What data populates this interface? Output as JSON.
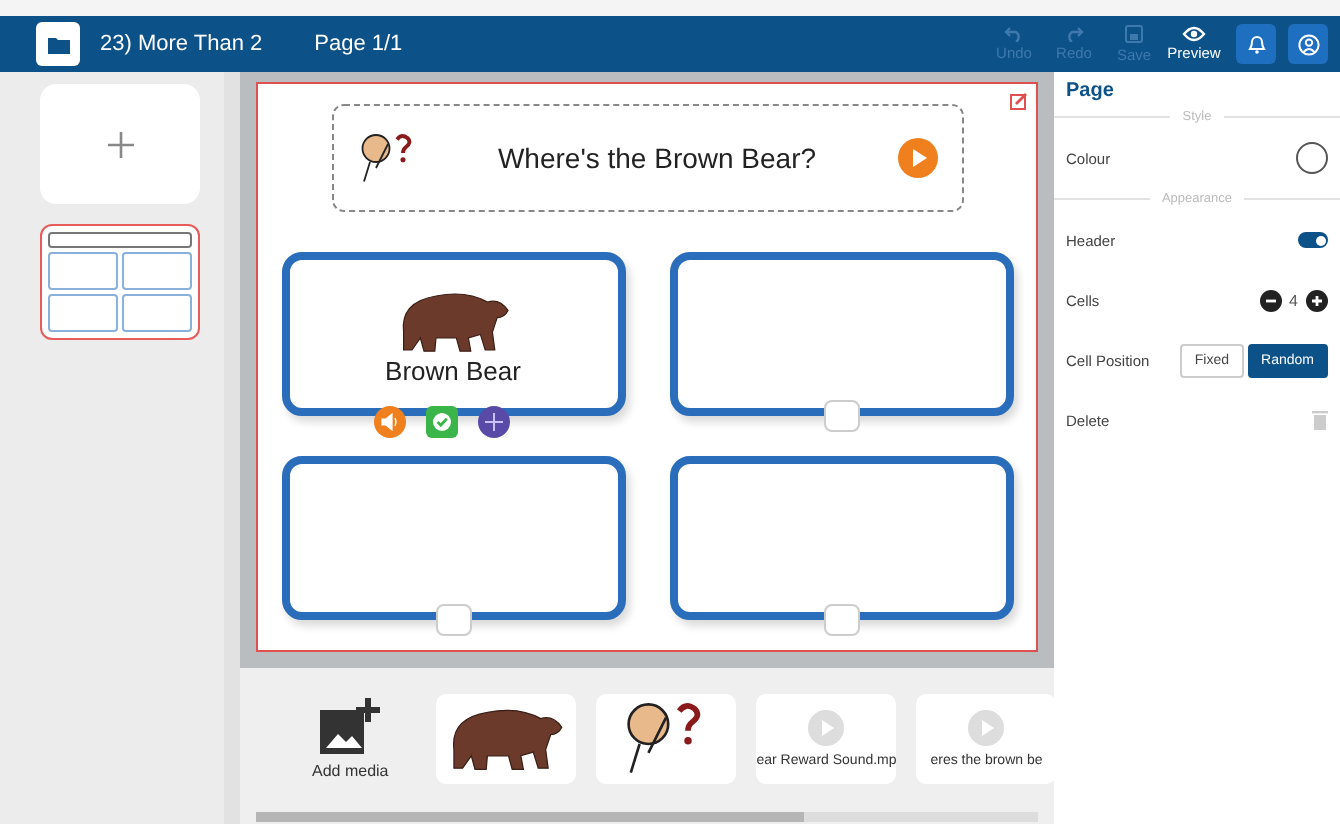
{
  "header": {
    "title": "23) More Than 2",
    "page": "Page 1/1",
    "tools": [
      {
        "kind": "undo",
        "label": "Undo",
        "disabled": true
      },
      {
        "kind": "redo",
        "label": "Redo",
        "disabled": true
      },
      {
        "kind": "save",
        "label": "Save",
        "disabled": true
      },
      {
        "kind": "preview",
        "label": "Preview",
        "disabled": false
      }
    ]
  },
  "pages": [
    {
      "selected": true
    }
  ],
  "question": {
    "text": "Where's the Brown Bear?"
  },
  "cells": [
    {
      "kind": "filled",
      "label": "Brown Bear"
    },
    {
      "kind": "empty"
    },
    {
      "kind": "empty"
    },
    {
      "kind": "empty"
    }
  ],
  "media": {
    "add_label": "Add media",
    "items": [
      {
        "kind": "bear"
      },
      {
        "kind": "thinker"
      },
      {
        "kind": "audio",
        "name": "ear Reward Sound.mp"
      },
      {
        "kind": "audio",
        "name": "eres the brown be"
      }
    ]
  },
  "panel": {
    "title": "Page",
    "style_heading": "Style",
    "colour_label": "Colour",
    "appearance_heading": "Appearance",
    "header_label": "Header",
    "header_on": true,
    "cells_label": "Cells",
    "cells_count": "4",
    "position_label": "Cell Position",
    "positions": [
      {
        "label": "Fixed",
        "selected": false
      },
      {
        "label": "Random",
        "selected": true
      }
    ],
    "delete_label": "Delete"
  }
}
